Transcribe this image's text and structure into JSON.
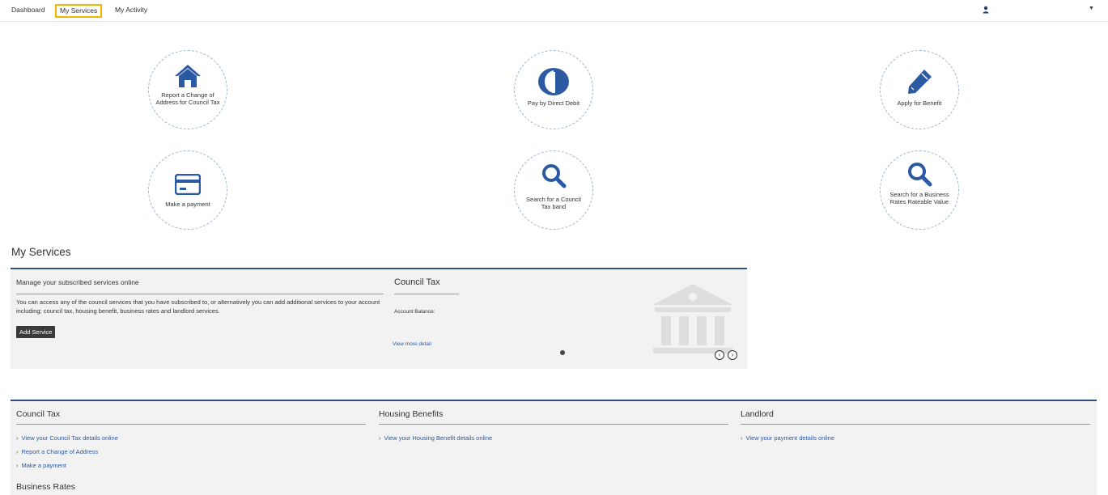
{
  "nav": {
    "dashboard": "Dashboard",
    "my_services": "My Services",
    "my_activity": "My Activity"
  },
  "tiles": {
    "change_address": "Report a Change of Address for Council Tax",
    "direct_debit": "Pay by Direct Debit",
    "benefit": "Apply for Benefit",
    "payment": "Make a payment",
    "ct_band": "Search for a Council Tax band",
    "rates": "Search for a Business Rates Rateable Value"
  },
  "section_title": "My Services",
  "panel": {
    "manage_title": "Manage your subscribed services online",
    "manage_text": "You can access any of the council services that you have subscribed to, or alternatively you can add additional services to your account including; council tax, housing benefit, business rates and landlord services.",
    "add_service": "Add Service",
    "ct_title": "Council Tax",
    "balance_label": "Account Balance:",
    "more_detail": "View more detail"
  },
  "lists": {
    "council_tax": {
      "title": "Council Tax",
      "links": [
        "View your Council Tax details online",
        "Report a Change of Address",
        "Make a payment"
      ]
    },
    "housing": {
      "title": "Housing Benefits",
      "links": [
        "View your Housing Benefit details online"
      ]
    },
    "landlord": {
      "title": "Landlord",
      "links": [
        "View your payment details online"
      ]
    },
    "business_rates_title": "Business Rates"
  },
  "colors": {
    "brand_blue": "#2b5aa3",
    "highlight": "#f5b400",
    "panel_bg": "#f2f2f2"
  },
  "icons": {
    "user": "user-icon",
    "caret": "caret-down-icon",
    "house": "house-icon",
    "direct_debit": "direct-debit-icon",
    "pencil": "pencil-icon",
    "card": "credit-card-icon",
    "search": "search-icon",
    "bank": "bank-icon"
  }
}
